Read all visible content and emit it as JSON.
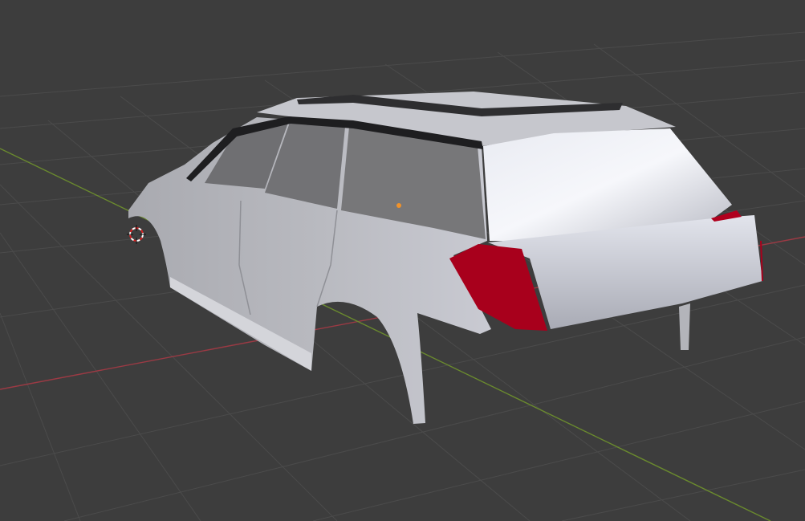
{
  "viewport": {
    "background": "#3d3d3d",
    "grid_color": "#4a4a4a",
    "x_axis_color": "#9b3a44",
    "y_axis_color": "#6a8a2e",
    "origin_color": "#f0922a"
  },
  "model": {
    "body_color": "#b9bac0",
    "window_color": "#6f6f72",
    "taillight_color": "#a8001c"
  }
}
